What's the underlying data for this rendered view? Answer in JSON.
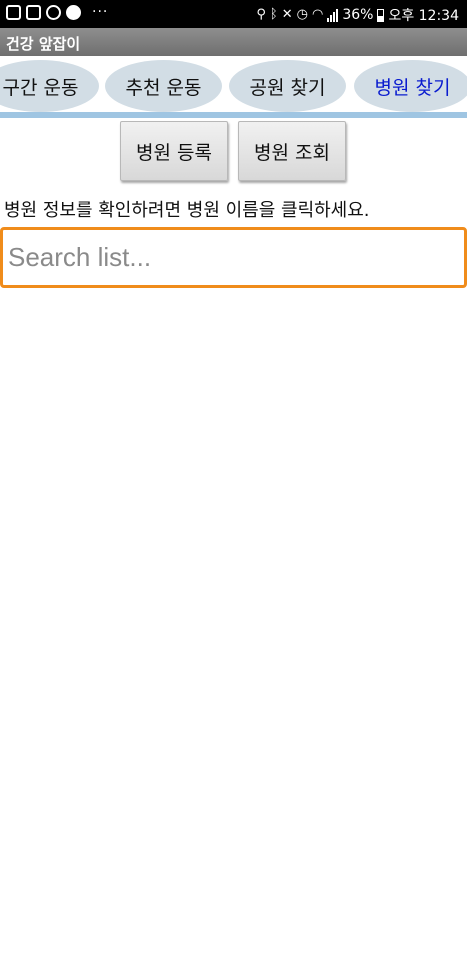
{
  "status_bar": {
    "battery_text": "36%",
    "time": "오후 12:34",
    "overflow": "···"
  },
  "app": {
    "title": "건강 앞잡이"
  },
  "tabs": [
    {
      "label": "구간 운동"
    },
    {
      "label": "추천 운동"
    },
    {
      "label": "공원 찾기"
    },
    {
      "label": "병원 찾기",
      "active": true
    }
  ],
  "actions": {
    "register": "병원 등록",
    "lookup": "병원 조회"
  },
  "instruction": "병원 정보를 확인하려면 병원 이름을 클릭하세요.",
  "search": {
    "placeholder": "Search list...",
    "value": ""
  },
  "colors": {
    "tab_active_text": "#0a1ccf",
    "tab_bg": "#d2dde5",
    "tab_divider": "#9fc5e2",
    "search_border": "#f08c1b"
  }
}
